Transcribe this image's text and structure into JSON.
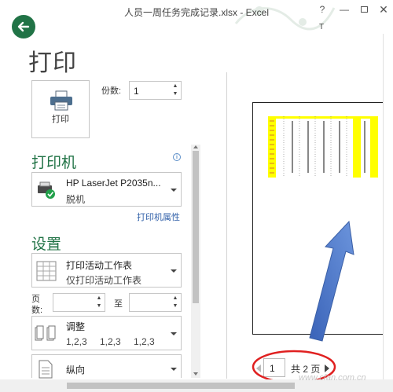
{
  "window": {
    "title": "人员一周任务完成记录.xlsx - Excel",
    "help_label": "?",
    "partial_label": "T"
  },
  "page": {
    "title": "打印"
  },
  "print": {
    "button_label": "打印",
    "copies_label": "份数:",
    "copies_value": "1"
  },
  "printer": {
    "heading": "打印机",
    "name": "HP LaserJet P2035n...",
    "status": "脱机",
    "properties_link": "打印机属性"
  },
  "settings": {
    "heading": "设置",
    "scope_main": "打印活动工作表",
    "scope_sub": "仅打印活动工作表",
    "pages_label_1": "页",
    "pages_label_2": "数:",
    "pages_from": "",
    "pages_to_label": "至",
    "pages_to": "",
    "collate_main": "调整",
    "collate_sub": [
      "1,2,3",
      "1,2,3",
      "1,2,3"
    ],
    "orientation": "纵向"
  },
  "preview": {
    "current_page": "1",
    "total_pages": "共 2 页"
  },
  "watermark": "www.cfan.com.cn",
  "colors": {
    "accent": "#217346",
    "highlight_cells": "#ffff00",
    "annotation_arrow": "#4a78c8",
    "annotation_circle": "#e02020"
  }
}
